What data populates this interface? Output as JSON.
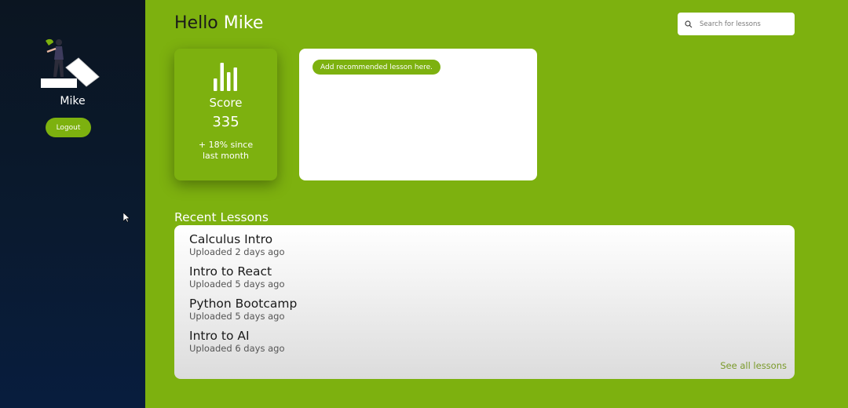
{
  "sidebar": {
    "username": "Mike",
    "logout_label": "Logout"
  },
  "header": {
    "greeting_prefix": "Hello",
    "greeting_name": "Mike",
    "search_placeholder": "Search for lessons"
  },
  "score": {
    "icon": "bar-chart-icon",
    "label": "Score",
    "value": "335",
    "delta": "+ 18% since last month"
  },
  "recommended": {
    "pill_label": "Add recommended lesson here."
  },
  "recent": {
    "title": "Recent Lessons",
    "lessons": [
      {
        "title": "Calculus Intro",
        "meta": "Uploaded 2 days ago"
      },
      {
        "title": "Intro to React",
        "meta": "Uploaded 5 days ago"
      },
      {
        "title": "Python Bootcamp",
        "meta": "Uploaded 5 days ago"
      },
      {
        "title": "Intro to AI",
        "meta": "Uploaded 6 days ago"
      }
    ],
    "see_all_label": "See all lessons"
  },
  "colors": {
    "accent": "#7db10f",
    "sidebar_bg": "#0a1a2f"
  }
}
